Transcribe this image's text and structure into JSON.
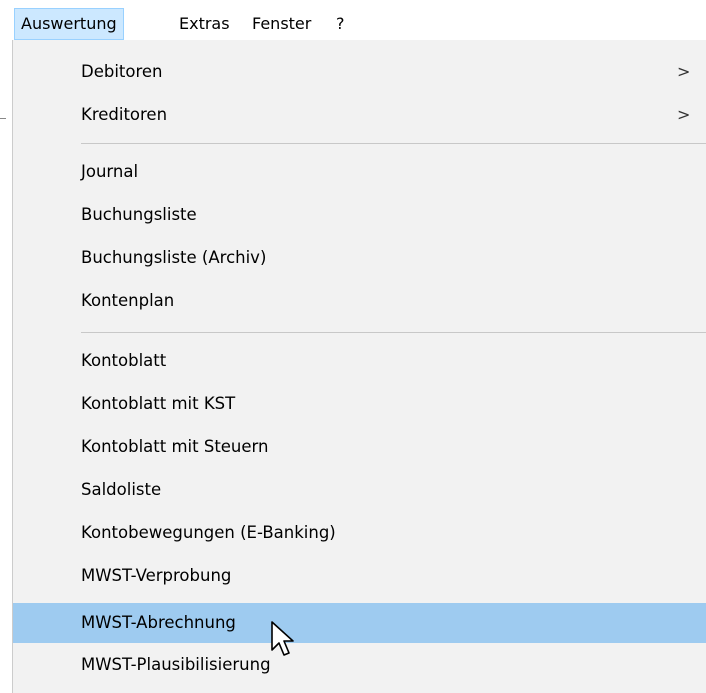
{
  "menubar": {
    "items": [
      {
        "label": "Auswertung",
        "active": true
      },
      {
        "label": "Extras"
      },
      {
        "label": "Fenster"
      },
      {
        "label": "?"
      }
    ]
  },
  "dropdown": {
    "submenu_arrow": ">",
    "groups": [
      {
        "items": [
          {
            "label": "Debitoren",
            "has_submenu": true
          },
          {
            "label": "Kreditoren",
            "has_submenu": true
          }
        ]
      },
      {
        "items": [
          {
            "label": "Journal"
          },
          {
            "label": "Buchungsliste"
          },
          {
            "label": "Buchungsliste (Archiv)"
          },
          {
            "label": "Kontenplan"
          }
        ]
      },
      {
        "items": [
          {
            "label": "Kontoblatt"
          },
          {
            "label": "Kontoblatt mit KST"
          },
          {
            "label": "Kontoblatt mit Steuern"
          },
          {
            "label": "Saldoliste"
          },
          {
            "label": "Kontobewegungen (E-Banking)"
          },
          {
            "label": "MWST-Verprobung"
          },
          {
            "label": "MWST-Abrechnung",
            "highlighted": true
          },
          {
            "label": "MWST-Plausibilisierung"
          }
        ]
      }
    ]
  },
  "colors": {
    "menu_background": "#f2f2f2",
    "highlight": "#9ecbf0",
    "active_menubar_item": "#cce8ff"
  },
  "icons": {
    "cursor": "mouse-pointer-icon"
  }
}
